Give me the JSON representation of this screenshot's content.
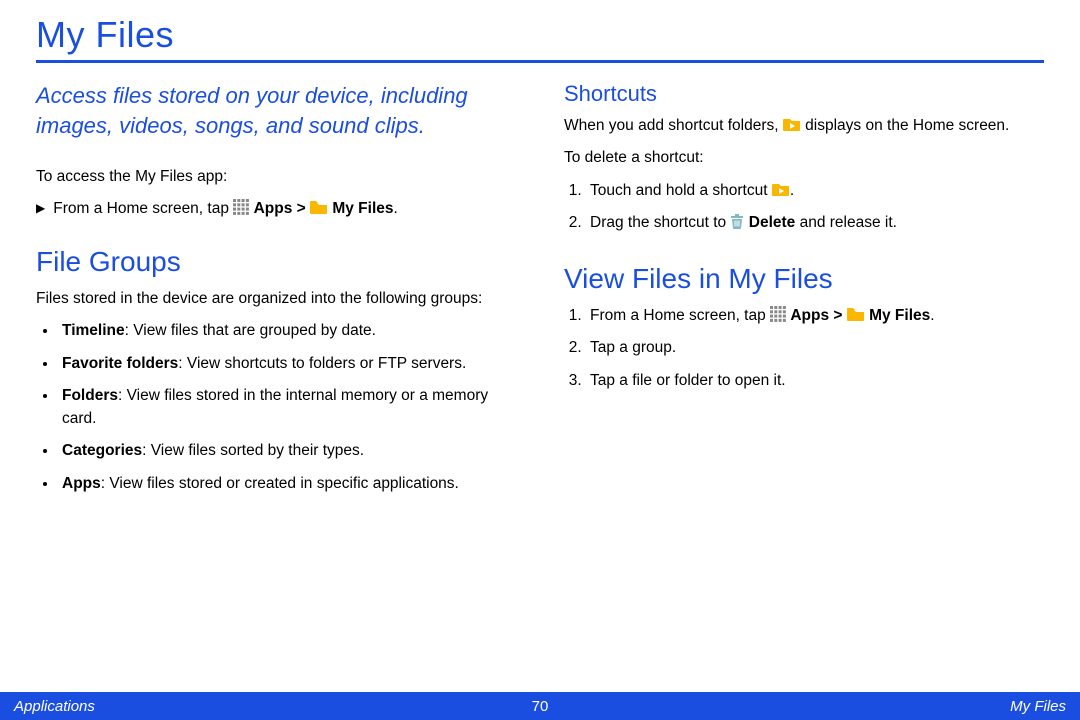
{
  "title": "My Files",
  "intro": "Access files stored on your device, including images, videos, songs, and sound clips.",
  "access_label": "To access the My Files app:",
  "access_step_prefix": "From a Home screen, tap",
  "apps_label": "Apps",
  "myfiles_label": "My Files",
  "file_groups": {
    "heading": "File Groups",
    "desc": "Files stored in the device are organized into the following groups:",
    "items": [
      {
        "name": "Timeline",
        "desc": ": View files that are grouped by date."
      },
      {
        "name": "Favorite folders",
        "desc": ": View shortcuts to folders or FTP servers."
      },
      {
        "name": "Folders",
        "desc": ": View files stored in the internal memory or a memory card."
      },
      {
        "name": "Categories",
        "desc": ": View files sorted by their types."
      },
      {
        "name": "Apps",
        "desc": ": View files stored or created in specific applications."
      }
    ]
  },
  "shortcuts": {
    "heading": "Shortcuts",
    "line1a": "When you add shortcut folders,",
    "line1b": "displays on the Home screen.",
    "delete_label": "To delete a shortcut:",
    "step1": "Touch and hold a shortcut",
    "step2a": "Drag the shortcut to",
    "step2b": "Delete",
    "step2c": "and release it."
  },
  "view": {
    "heading": "View Files in My Files",
    "step1_prefix": "From a Home screen, tap",
    "step2": "Tap a group.",
    "step3": "Tap a file or folder to open it."
  },
  "footer": {
    "left": "Applications",
    "center": "70",
    "right": "My Files"
  }
}
